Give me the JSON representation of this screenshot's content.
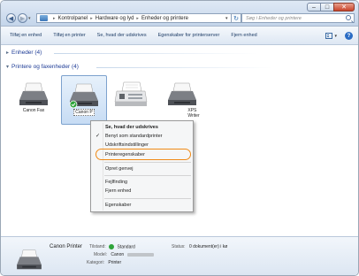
{
  "address": {
    "path": [
      "Kontrolpanel",
      "Hardware og lyd",
      "Enheder og printere"
    ]
  },
  "search": {
    "placeholder": "Søg i Enheder og printere"
  },
  "toolbar": {
    "items": [
      "Tilføj en enhed",
      "Tilføj en printer",
      "Se, hvad der udskrives",
      "Egenskaber for printerserver",
      "Fjern enhed"
    ]
  },
  "groups": {
    "devices": "Enheder (4)",
    "printers": "Printere og faxenheder (4)"
  },
  "printers": [
    {
      "label": "Canon Fax",
      "selected": false
    },
    {
      "label": "Canon P",
      "selected": true
    },
    {
      "label": "",
      "selected": false
    },
    {
      "label": "XPS\nWriter",
      "selected": false
    }
  ],
  "context_menu": {
    "items": [
      {
        "label": "Se, hvad der udskrives",
        "bold": true,
        "checked": false
      },
      {
        "label": "Benyt som standardprinter",
        "bold": false,
        "checked": true
      },
      {
        "label": "Udskriftsindstillinger",
        "bold": false,
        "checked": false
      },
      {
        "label": "Printeregenskaber",
        "bold": false,
        "checked": false,
        "highlighted": true
      },
      {
        "label": "Opret genvej",
        "bold": false,
        "checked": false
      },
      {
        "label": "Fejlfinding",
        "bold": false,
        "checked": false
      },
      {
        "label": "Fjern enhed",
        "bold": false,
        "checked": false
      },
      {
        "label": "Egenskaber",
        "bold": false,
        "checked": false
      }
    ]
  },
  "details": {
    "name": "Canon Printer",
    "state_key": "Tilstand:",
    "state_val": "Standard",
    "status_key": "Status:",
    "status_val": "0 dokument(er) i kø",
    "model_key": "Model:",
    "model_val": "Canon",
    "category_key": "Kategori:",
    "category_val": "Printer"
  },
  "colors": {
    "accent": "#1e3c96",
    "highlight_ring": "#f08a16",
    "default_check": "#2ea43a"
  }
}
